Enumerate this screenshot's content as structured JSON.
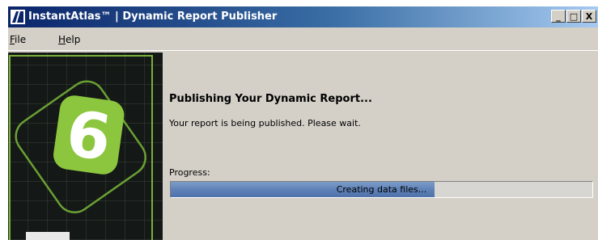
{
  "window": {
    "title": "InstantAtlas™ | Dynamic Report Publisher",
    "app_icon": "instantatlas-logo-icon",
    "controls": {
      "minimize": "_",
      "maximize": "□",
      "close": "X"
    }
  },
  "menu": {
    "file": {
      "accel": "F",
      "rest": "ile"
    },
    "help": {
      "accel": "H",
      "rest": "elp"
    }
  },
  "sidebar": {
    "badge_number": "6",
    "badge_color": "#8cc63f"
  },
  "content": {
    "heading": "Publishing Your Dynamic Report...",
    "message": "Your report is being published. Please wait."
  },
  "progress": {
    "label": "Progress:",
    "status_text": "Creating data files...",
    "fraction": 0.625,
    "fill_color": "#5f82b8"
  }
}
